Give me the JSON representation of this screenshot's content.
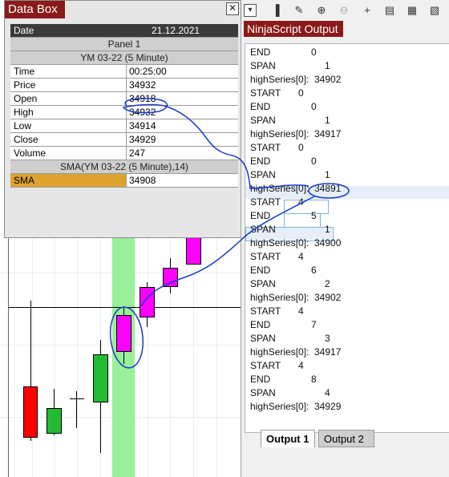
{
  "colors": {
    "title_bar": "#8a1a1a",
    "candle_magenta": "#ff00ff",
    "candle_green": "#22bb33",
    "candle_red": "#ff0000",
    "highlight_bar": "#98f098",
    "sma_label": "#e0a22e",
    "annotation": "#1a3cc8"
  },
  "databox": {
    "title": "Data Box",
    "close_icon": "close-icon",
    "date_label": "Date",
    "date_value": "21.12.2021",
    "panel": "Panel 1",
    "instrument": "YM 03-22 (5 Minute)",
    "rows": [
      {
        "label": "Time",
        "value": "00:25:00"
      },
      {
        "label": "Price",
        "value": "34932"
      },
      {
        "label": "Open",
        "value": "34918"
      },
      {
        "label": "High",
        "value": "34932"
      },
      {
        "label": "Low",
        "value": "34914"
      },
      {
        "label": "Close",
        "value": "34929"
      },
      {
        "label": "Volume",
        "value": "247"
      }
    ],
    "indicator_header": "SMA(YM 03-22 (5 Minute),14)",
    "indicator_label": "SMA",
    "indicator_value": "34908"
  },
  "toolbar": {
    "icons": [
      "chevron-down-icon",
      "bar-chart-icon",
      "pencil-icon",
      "zoom-in-icon",
      "zoom-out-icon",
      "crosshair-icon",
      "properties-icon",
      "strategies-icon",
      "indicators-icon"
    ]
  },
  "output": {
    "title": "NinjaScript Output",
    "lines": [
      {
        "key": "END",
        "val": "0"
      },
      {
        "key": "SPAN",
        "val": "1"
      },
      {
        "key": "highSeries[0]:",
        "val": "34902"
      },
      {
        "key": "START",
        "val": "0"
      },
      {
        "key": "END",
        "val": "0"
      },
      {
        "key": "SPAN",
        "val": "1"
      },
      {
        "key": "highSeries[0]:",
        "val": "34917"
      },
      {
        "key": "START",
        "val": "0"
      },
      {
        "key": "END",
        "val": "0"
      },
      {
        "key": "SPAN",
        "val": "1"
      },
      {
        "key": "highSeries[0]:",
        "val": "34891"
      },
      {
        "key": "START",
        "val": "4"
      },
      {
        "key": "END",
        "val": "5"
      },
      {
        "key": "SPAN",
        "val": "1"
      },
      {
        "key": "highSeries[0]:",
        "val": "34900"
      },
      {
        "key": "START",
        "val": "4"
      },
      {
        "key": "END",
        "val": "6"
      },
      {
        "key": "SPAN",
        "val": "2"
      },
      {
        "key": "highSeries[0]:",
        "val": "34902"
      },
      {
        "key": "START",
        "val": "4"
      },
      {
        "key": "END",
        "val": "7"
      },
      {
        "key": "SPAN",
        "val": "3"
      },
      {
        "key": "highSeries[0]:",
        "val": "34917"
      },
      {
        "key": "START",
        "val": "4"
      },
      {
        "key": "END",
        "val": "8"
      },
      {
        "key": "SPAN",
        "val": "4"
      },
      {
        "key": "highSeries[0]:",
        "val": "34929"
      }
    ],
    "tabs": [
      {
        "label": "Output 1",
        "active": true
      },
      {
        "label": "Output 2",
        "active": false
      }
    ]
  }
}
